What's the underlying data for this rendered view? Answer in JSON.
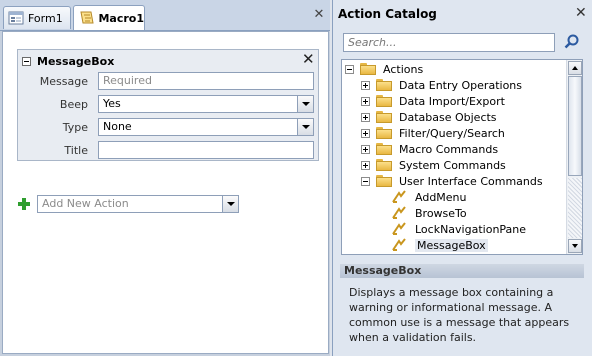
{
  "tabs": [
    {
      "label": "Form1",
      "icon": "form-icon"
    },
    {
      "label": "Macro1",
      "icon": "macro-icon"
    }
  ],
  "macro_block": {
    "title": "MessageBox",
    "fields": [
      {
        "label": "Message",
        "value": "",
        "placeholder": "Required",
        "type": "text"
      },
      {
        "label": "Beep",
        "value": "Yes",
        "type": "dropdown"
      },
      {
        "label": "Type",
        "value": "None",
        "type": "dropdown"
      },
      {
        "label": "Title",
        "value": "",
        "type": "text"
      }
    ]
  },
  "add_action": {
    "placeholder": "Add New Action"
  },
  "catalog": {
    "title": "Action Catalog",
    "search_placeholder": "Search...",
    "tree": [
      {
        "label": "Actions",
        "level": 0,
        "kind": "folder",
        "expanded": true
      },
      {
        "label": "Data Entry Operations",
        "level": 1,
        "kind": "folder",
        "expanded": false
      },
      {
        "label": "Data Import/Export",
        "level": 1,
        "kind": "folder",
        "expanded": false
      },
      {
        "label": "Database Objects",
        "level": 1,
        "kind": "folder",
        "expanded": false
      },
      {
        "label": "Filter/Query/Search",
        "level": 1,
        "kind": "folder",
        "expanded": false
      },
      {
        "label": "Macro Commands",
        "level": 1,
        "kind": "folder",
        "expanded": false
      },
      {
        "label": "System Commands",
        "level": 1,
        "kind": "folder",
        "expanded": false
      },
      {
        "label": "User Interface Commands",
        "level": 1,
        "kind": "folder",
        "expanded": true
      },
      {
        "label": "AddMenu",
        "level": 2,
        "kind": "action"
      },
      {
        "label": "BrowseTo",
        "level": 2,
        "kind": "action"
      },
      {
        "label": "LockNavigationPane",
        "level": 2,
        "kind": "action"
      },
      {
        "label": "MessageBox",
        "level": 2,
        "kind": "action",
        "selected": true
      }
    ],
    "help_title": "MessageBox",
    "help_text": "Displays a message box containing a warning or informational message. A common use is a message that appears when a validation fails."
  },
  "colors": {
    "accent": "#2f9e2f",
    "folder": "#e9b843",
    "pane": "#dfe6f0"
  }
}
